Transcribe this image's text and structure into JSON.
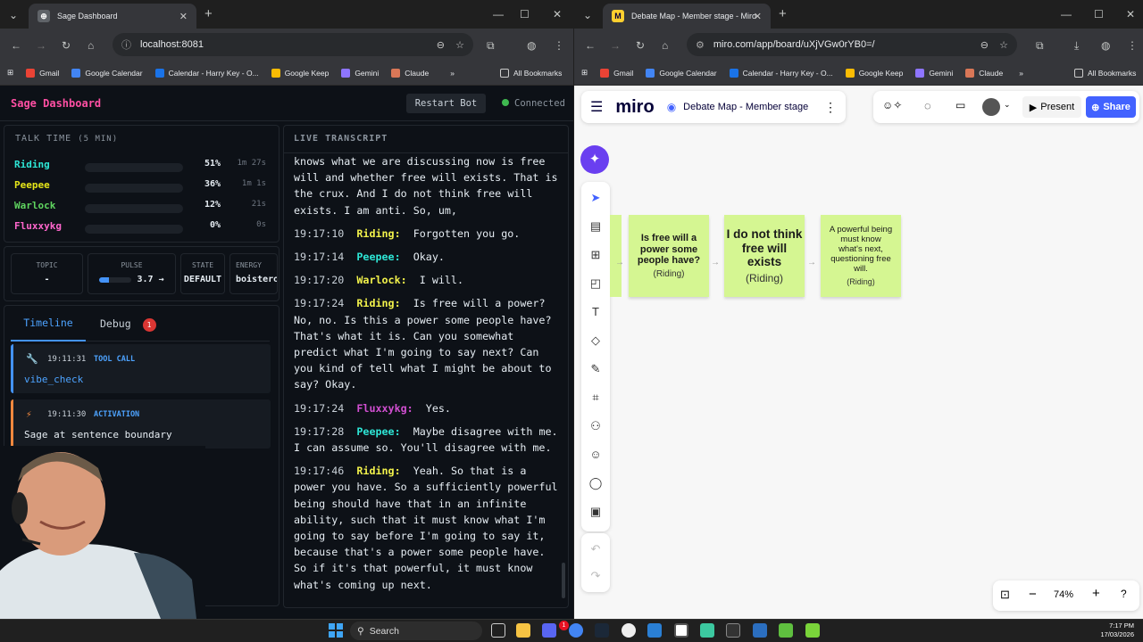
{
  "left_browser": {
    "tab_title": "Sage Dashboard",
    "url": "localhost:8081",
    "bookmarks": [
      "Gmail",
      "Google Calendar",
      "Calendar - Harry Key - O...",
      "Google Keep",
      "Gemini",
      "Claude"
    ],
    "all_bookmarks": "All Bookmarks"
  },
  "right_browser": {
    "tab_title": "Debate Map - Member stage - Miro",
    "url": "miro.com/app/board/uXjVGw0rYB0=/",
    "bookmarks": [
      "Gmail",
      "Google Calendar",
      "Calendar - Harry Key - O...",
      "Google Keep",
      "Gemini",
      "Claude"
    ],
    "all_bookmarks": "All Bookmarks"
  },
  "dashboard": {
    "title": "Sage Dashboard",
    "restart_label": "Restart Bot",
    "status": "Connected",
    "talk_time": {
      "title": "TALK TIME",
      "window": "(5 MIN)",
      "speakers": [
        {
          "name": "Riding",
          "pct_label": "51%",
          "duration": "1m 27s",
          "fraction": 0.51,
          "color": "#2ee6d6"
        },
        {
          "name": "Peepee",
          "pct_label": "36%",
          "duration": "1m 1s",
          "fraction": 0.36,
          "color": "#e6e619"
        },
        {
          "name": "Warlock",
          "pct_label": "12%",
          "duration": "21s",
          "fraction": 0.12,
          "color": "#5fd45f"
        },
        {
          "name": "Fluxxykg",
          "pct_label": "0%",
          "duration": "0s",
          "fraction": 0.0,
          "color": "#ff66cc"
        }
      ]
    },
    "stats": {
      "topic_label": "TOPIC",
      "topic_value": "-",
      "pulse_label": "PULSE",
      "pulse_value": "3.7 →",
      "pulse_fraction": 0.3,
      "state_label": "STATE",
      "state_value": "DEFAULT",
      "energy_label": "ENERGY",
      "energy_value": "boisterous"
    },
    "tabs": {
      "timeline": "Timeline",
      "debug": "Debug",
      "debug_count": "1"
    },
    "events": [
      {
        "time": "19:11:31",
        "kind": "TOOL CALL",
        "body": "vibe_check",
        "icon": "wrench-icon"
      },
      {
        "time": "19:11:30",
        "kind": "ACTIVATION",
        "body": "Sage at sentence boundary",
        "icon": "lightning-icon"
      }
    ],
    "transcript_title": "LIVE TRANSCRIPT",
    "transcript_lead": "knows what we are discussing now is free will and whether free will exists. That is the crux. And I do not think free will exists. I am anti. So, um,",
    "transcript": [
      {
        "time": "19:17:10",
        "speaker": "Riding:",
        "text": "Forgotten you go.",
        "color": "#f2f24b"
      },
      {
        "time": "19:17:14",
        "speaker": "Peepee:",
        "text": "Okay.",
        "color": "#2ee6d6"
      },
      {
        "time": "19:17:20",
        "speaker": "Warlock:",
        "text": "I will.",
        "color": "#f2f24b"
      },
      {
        "time": "19:17:24",
        "speaker": "Riding:",
        "text": "Is free will a power? No, no. Is this a power some people have? That's what it is. Can you somewhat predict what I'm going to say next? Can you kind of tell what I might be about to say? Okay.",
        "color": "#f2f24b"
      },
      {
        "time": "19:17:24",
        "speaker": "Fluxxykg:",
        "text": "Yes.",
        "color": "#d14fd1"
      },
      {
        "time": "19:17:28",
        "speaker": "Peepee:",
        "text": "Maybe disagree with me. I can assume so. You'll disagree with me.",
        "color": "#2ee6d6"
      },
      {
        "time": "19:17:46",
        "speaker": "Riding:",
        "text": "Yeah. So that is a power you have. So a sufficiently powerful being should have that in an infinite ability, such that it must know what I'm going to say before I'm going to say it, because that's a power some people have. So if it's that powerful, it must know what's coming up next.",
        "color": "#f2f24b"
      }
    ]
  },
  "miro": {
    "logo": "miro",
    "board": "Debate Map - Member stage",
    "present": "Present",
    "share": "Share",
    "zoom": "74%",
    "stickies": [
      {
        "q": "Is free will a power some people have?",
        "a": "(Riding)"
      },
      {
        "q": "I do not think free will exists",
        "a": "(Riding)"
      },
      {
        "q": "A powerful being must know what's next, questioning free will.",
        "a": "(Riding)"
      }
    ]
  },
  "taskbar": {
    "search": "Search",
    "time": "7:17 PM",
    "date": "17/03/2026",
    "debug_badge": "1"
  }
}
